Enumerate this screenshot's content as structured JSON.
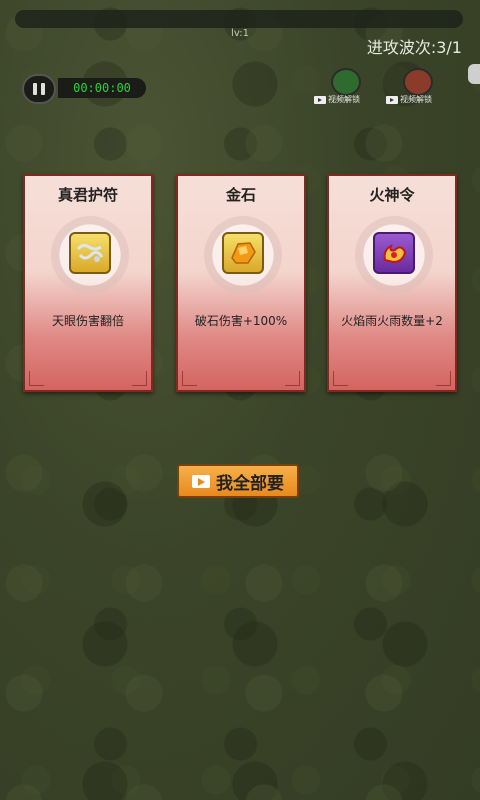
{
  "hud": {
    "level": "lv:1",
    "wave": "进攻波次:3/1",
    "timer": "00:00:00"
  },
  "unlocks": [
    {
      "label": "视频解锁",
      "color": "#2f6b2f"
    },
    {
      "label": "视频解锁",
      "color": "#8a3b2a"
    }
  ],
  "cards": [
    {
      "title": "真君护符",
      "icon": "amulet-icon",
      "desc": "天眼伤害翻倍",
      "icon_color": "#e7c44a"
    },
    {
      "title": "金石",
      "icon": "gold-stone-icon",
      "desc": "破石伤害+100%",
      "icon_color": "#f0b81e"
    },
    {
      "title": "火神令",
      "icon": "fire-token-icon",
      "desc": "火焰雨火雨数量+2",
      "icon_color": "#7a3bb0"
    }
  ],
  "take_all": {
    "label": "我全部要"
  }
}
